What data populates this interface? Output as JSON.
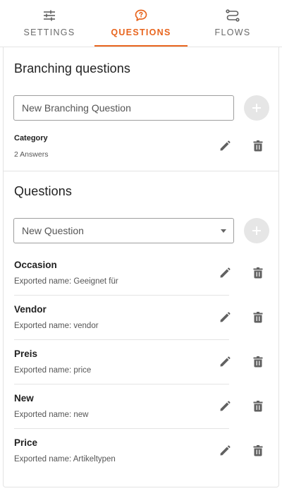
{
  "tabs": [
    {
      "label": "SETTINGS",
      "icon": "sliders-icon",
      "active": false
    },
    {
      "label": "QUESTIONS",
      "icon": "question-bubble-icon",
      "active": true
    },
    {
      "label": "FLOWS",
      "icon": "flows-icon",
      "active": false
    }
  ],
  "colors": {
    "accent": "#e8651e",
    "icon": "#616161",
    "fab_bg": "#e6e6e6"
  },
  "branching": {
    "title": "Branching questions",
    "input_value": "New Branching Question",
    "add_icon": "plus-icon",
    "items": [
      {
        "title": "Category",
        "subtitle": "2 Answers"
      }
    ]
  },
  "questions": {
    "title": "Questions",
    "select_value": "New Question",
    "add_icon": "plus-icon",
    "items": [
      {
        "title": "Occasion",
        "subtitle": "Exported name: Geeignet für"
      },
      {
        "title": "Vendor",
        "subtitle": "Exported name: vendor"
      },
      {
        "title": "Preis",
        "subtitle": "Exported name: price"
      },
      {
        "title": "New",
        "subtitle": "Exported name: new"
      },
      {
        "title": "Price",
        "subtitle": "Exported name: Artikeltypen"
      }
    ]
  }
}
